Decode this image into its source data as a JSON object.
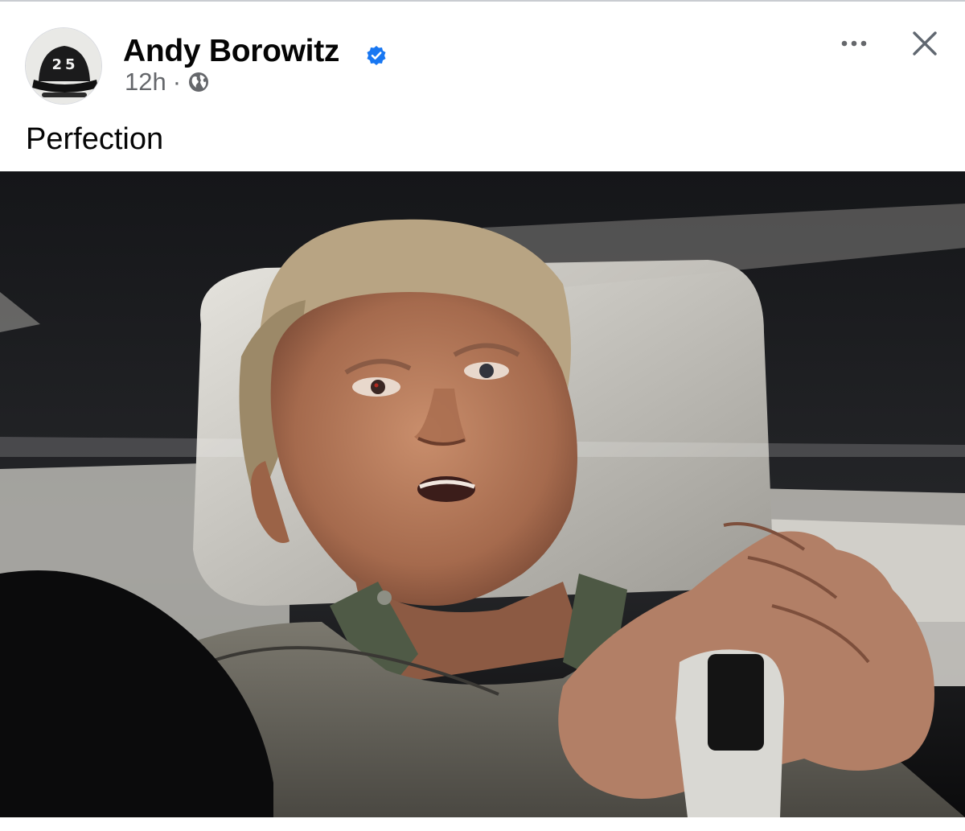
{
  "post": {
    "author": {
      "name": "Andy Borowitz",
      "verified": true,
      "avatar_icon": "hat-avatar-icon",
      "avatar_text": "25"
    },
    "meta": {
      "time": "12h",
      "separator": "·",
      "audience_icon": "globe-icon"
    },
    "caption": "Perfection",
    "actions": {
      "more_icon": "more-options-icon",
      "close_icon": "close-icon"
    },
    "photo": {
      "subject": "man-in-car-back-seat"
    }
  },
  "colors": {
    "text_primary": "#050505",
    "text_secondary": "#65676b",
    "verified_blue": "#1877f2",
    "background": "#ffffff"
  }
}
